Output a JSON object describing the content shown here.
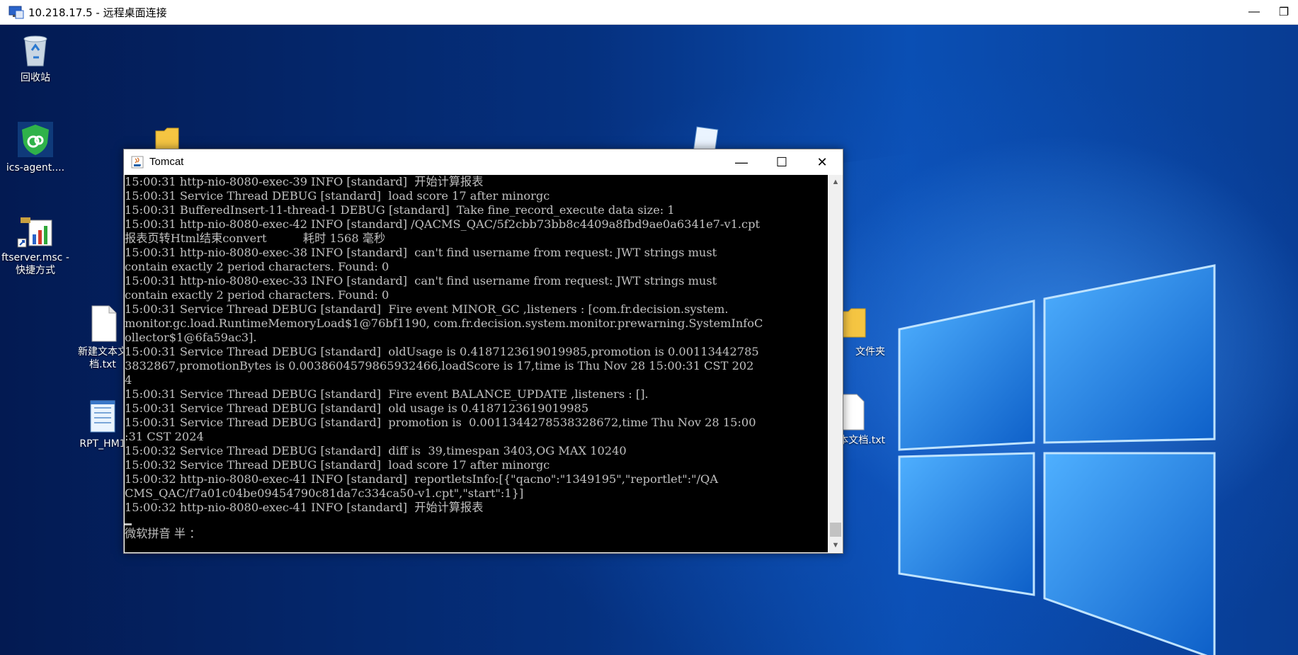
{
  "rdp": {
    "title": "10.218.17.5 - 远程桌面连接",
    "minimize": "—",
    "restore": "❐"
  },
  "desktop": {
    "icons": [
      {
        "id": "recycle-bin",
        "label": "回收站"
      },
      {
        "id": "ics-agent",
        "label": "ics-agent...."
      },
      {
        "id": "ftserver",
        "label": "ftserver.msc - 快捷方式"
      },
      {
        "id": "new-text-1",
        "label": "新建文本文档.txt"
      },
      {
        "id": "rpt",
        "label": "RPT_HM1"
      },
      {
        "id": "folder-right",
        "label": "文件夹"
      },
      {
        "id": "text-right",
        "label": "本文档.txt"
      }
    ]
  },
  "tomcat": {
    "title": "Tomcat",
    "minimize": "—",
    "maximize": "☐",
    "close": "✕",
    "log": [
      "15:00:31 http-nio-8080-exec-39 INFO [standard]  开始计算报表",
      "15:00:31 Service Thread DEBUG [standard]  load score 17 after minorgc",
      "15:00:31 BufferedInsert-11-thread-1 DEBUG [standard]  Take fine_record_execute data size: 1",
      "15:00:31 http-nio-8080-exec-42 INFO [standard] /QACMS_QAC/5f2cbb73bb8c4409a8fbd9ae0a6341e7-v1.cpt",
      "报表页转Html结束convert          耗时 1568 毫秒",
      "15:00:31 http-nio-8080-exec-38 INFO [standard]  can't find username from request: JWT strings must",
      "contain exactly 2 period characters. Found: 0",
      "15:00:31 http-nio-8080-exec-33 INFO [standard]  can't find username from request: JWT strings must",
      "contain exactly 2 period characters. Found: 0",
      "15:00:31 Service Thread DEBUG [standard]  Fire event MINOR_GC ,listeners : [com.fr.decision.system.",
      "monitor.gc.load.RuntimeMemoryLoad$1@76bf1190, com.fr.decision.system.monitor.prewarning.SystemInfoC",
      "ollector$1@6fa59ac3].",
      "15:00:31 Service Thread DEBUG [standard]  oldUsage is 0.4187123619019985,promotion is 0.00113442785",
      "3832867,promotionBytes is 0.0038604579865932466,loadScore is 17,time is Thu Nov 28 15:00:31 CST 202",
      "4",
      "15:00:31 Service Thread DEBUG [standard]  Fire event BALANCE_UPDATE ,listeners : [].",
      "15:00:31 Service Thread DEBUG [standard]  old usage is 0.4187123619019985",
      "15:00:31 Service Thread DEBUG [standard]  promotion is  0.0011344278538328672,time Thu Nov 28 15:00",
      ":31 CST 2024",
      "15:00:32 Service Thread DEBUG [standard]  diff is  39,timespan 3403,OG MAX 10240",
      "15:00:32 Service Thread DEBUG [standard]  load score 17 after minorgc",
      "15:00:32 http-nio-8080-exec-41 INFO [standard]  reportletsInfo:[{\"qacno\":\"1349195\",\"reportlet\":\"/QA",
      "CMS_QAC/f7a01c04be09454790c81da7c334ca50-v1.cpt\",\"start\":1}]",
      "15:00:32 http-nio-8080-exec-41 INFO [standard]  开始计算报表"
    ],
    "ime_status": "微软拼音 半 ："
  }
}
